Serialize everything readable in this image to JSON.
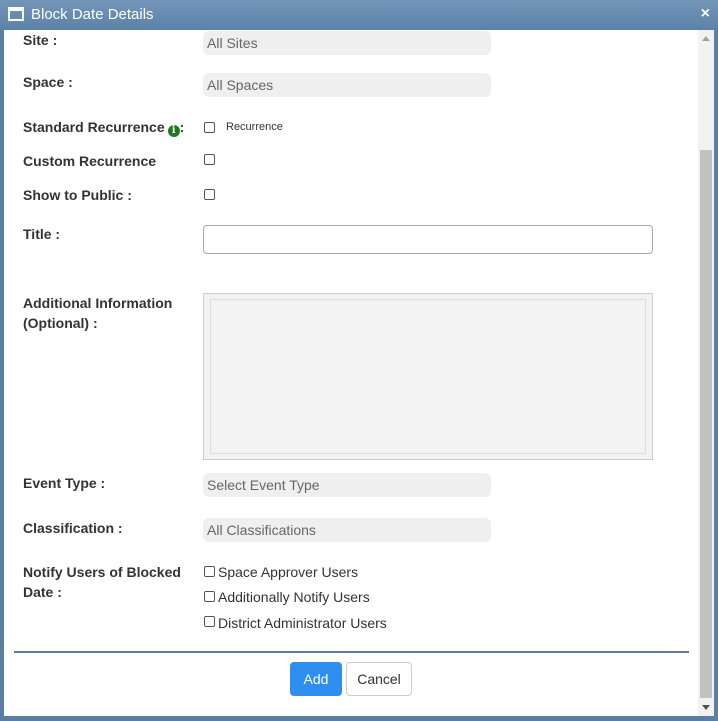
{
  "window": {
    "title": "Block Date Details",
    "close_glyph": "×"
  },
  "fields": {
    "site": {
      "label": "Site :",
      "value": "All Sites"
    },
    "space": {
      "label": "Space :",
      "value": "All Spaces"
    },
    "standard_recurrence": {
      "label": "Standard Recurrence",
      "label_suffix": ":",
      "info_glyph": "i",
      "option": "Recurrence",
      "checked": false
    },
    "custom_recurrence": {
      "label": "Custom Recurrence",
      "checked": false
    },
    "show_to_public": {
      "label": "Show to Public :",
      "checked": false
    },
    "title": {
      "label": "Title :",
      "value": ""
    },
    "additional_info": {
      "label_line1": "Additional Information",
      "label_line2": "(Optional) :",
      "value": ""
    },
    "event_type": {
      "label": "Event Type :",
      "value": "Select Event Type"
    },
    "classification": {
      "label": "Classification :",
      "value": "All Classifications"
    },
    "notify": {
      "label_line1": "Notify Users of Blocked",
      "label_line2": "Date :",
      "options": [
        "Space Approver Users",
        "Additionally Notify Users",
        "District Administrator Users"
      ]
    }
  },
  "buttons": {
    "add": "Add",
    "cancel": "Cancel"
  },
  "colors": {
    "titlebar": "#5d82a8",
    "primary_button": "#2e8ff0",
    "info_icon": "#1f7a1f"
  },
  "icons": {
    "window": "window-icon",
    "close": "close-icon",
    "info": "info-icon"
  }
}
